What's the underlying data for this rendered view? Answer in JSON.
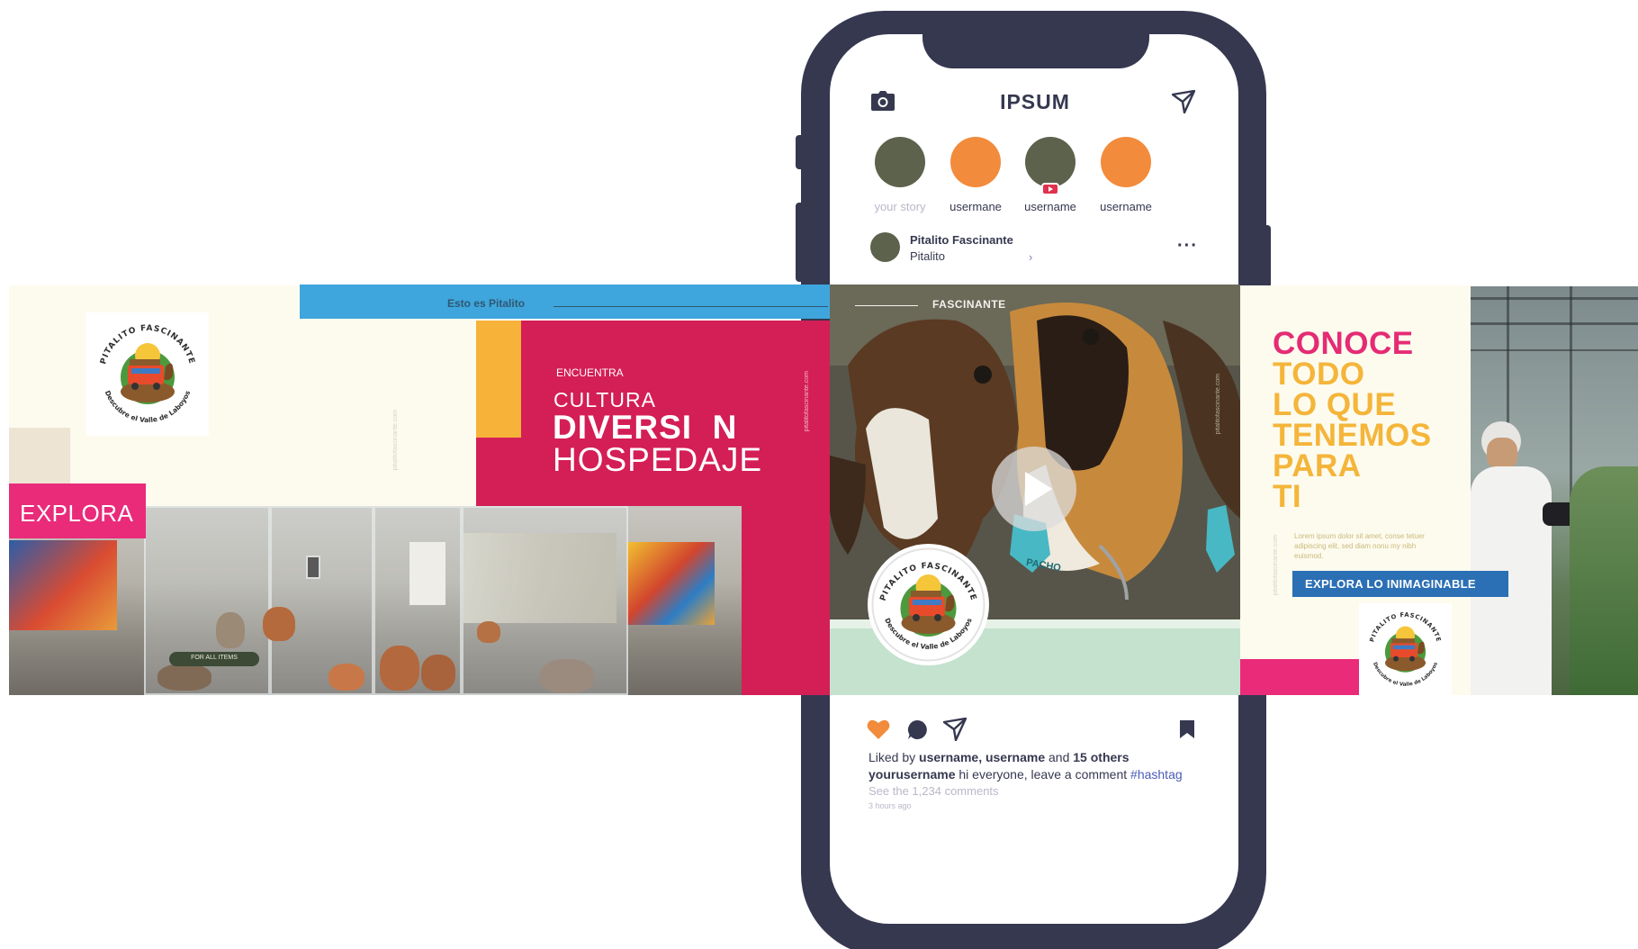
{
  "phone": {
    "app_title": "IPSUM",
    "stories": [
      {
        "label": "your story",
        "color": "#5d624c",
        "muted": true
      },
      {
        "label": "usermane",
        "color": "#f28b3c"
      },
      {
        "label": "username",
        "color": "#5d624c",
        "live": true
      },
      {
        "label": "username",
        "color": "#f28b3c"
      }
    ],
    "post": {
      "author": "Pitalito Fascinante",
      "location": "Pitalito",
      "liked_prefix": "Liked by",
      "liked_users": "username, username",
      "liked_and": "and",
      "liked_others": "15 others",
      "caption_user": "yourusername",
      "caption_text": "hi everyone, leave a comment",
      "caption_hashtag": "#hashtag",
      "comments": "See the 1,234 comments",
      "time": "3 hours ago"
    }
  },
  "left_banner": {
    "top_bar_text": "Esto es Pitalito",
    "explora": "EXPLORA",
    "encuentra": "ENCUENTRA",
    "cultura": "CULTURA",
    "diversion": "DIVERSI  N",
    "hospedaje": "HOSPEDAJE",
    "website": "pitalitofascinante.com",
    "museum_tag": "FOR ALL ITEMS"
  },
  "center": {
    "label": "FASCINANTE",
    "tag_text": "PACHO",
    "website": "pitalitofascinante.com"
  },
  "right_banner": {
    "headline": [
      "CONOCE",
      "TODO",
      "LO QUE",
      "TENEMOS",
      "PARA",
      "TI"
    ],
    "lorem": "Lorem ipsum dolor sit amet, conse tetuer adipiscing elit, sed diam nonu my nibh euismod.",
    "button": "EXPLORA LO INIMAGINABLE",
    "website": "pitalitofascinante.com"
  },
  "logo": {
    "top": "PITALITO FASCINANTE",
    "bottom": "Descubre el Valle de Laboyos"
  },
  "colors": {
    "phone_frame": "#363850",
    "magenta": "#d41e56",
    "pink": "#e92b7a",
    "blue": "#3ea6dc",
    "orange": "#f6b239",
    "olive": "#5d624c",
    "cream": "#fdfbee",
    "button_blue": "#2b6fb4"
  }
}
